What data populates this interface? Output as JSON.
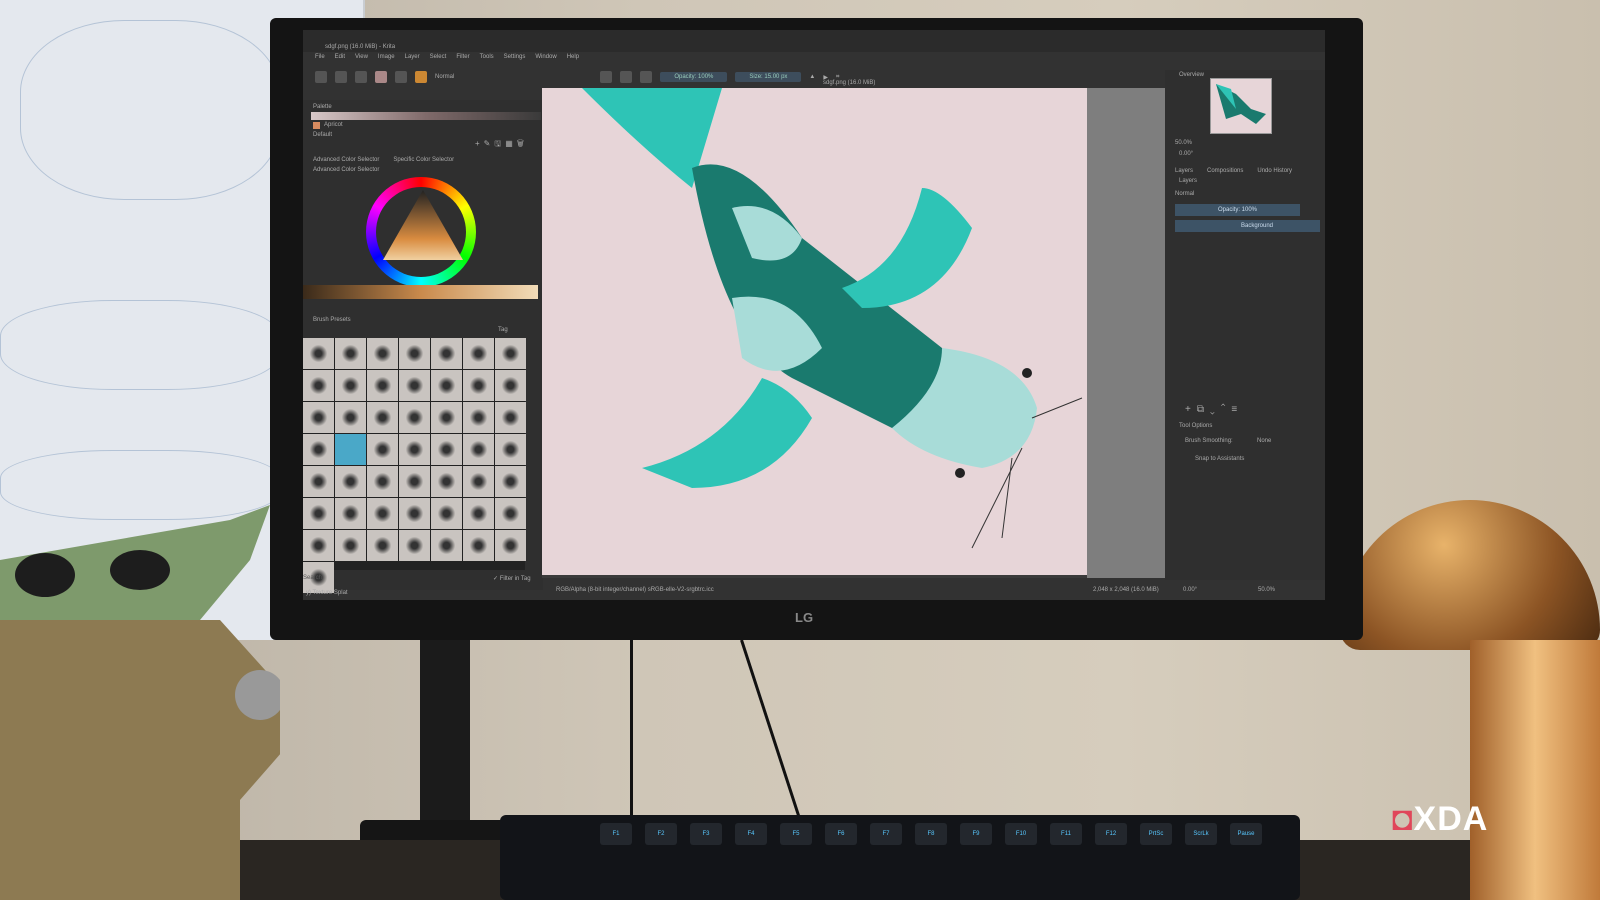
{
  "window": {
    "title": "sdgf.png (16.0 MiB) - Krita",
    "canvas_tab": "sdgf.png (16.0 MiB)"
  },
  "menu": [
    "File",
    "Edit",
    "View",
    "Image",
    "Layer",
    "Select",
    "Filter",
    "Tools",
    "Settings",
    "Window",
    "Help"
  ],
  "toolbar": {
    "blend_mode": "Normal",
    "opacity": "Opacity: 100%",
    "size": "Size: 15.00 px"
  },
  "palette": {
    "title": "Palette",
    "color_name": "Apricot",
    "palette_name": "Default"
  },
  "color_selector": {
    "tabs": [
      "Advanced Color Selector",
      "Specific Color Selector"
    ],
    "title": "Advanced Color Selector"
  },
  "brush_presets": {
    "title": "Brush Presets",
    "tag_label": "Tag",
    "search_placeholder": "Search",
    "filter_label": "Filter in Tag",
    "current_preset": "y) Texture Splat"
  },
  "overview": {
    "title": "Overview",
    "zoom": "50.0%",
    "rotation": "0.00°"
  },
  "layers": {
    "tabs": [
      "Layers",
      "Compositions",
      "Undo History"
    ],
    "title": "Layers",
    "blend_mode": "Normal",
    "opacity": "Opacity: 100%",
    "items": [
      {
        "name": "Background"
      }
    ]
  },
  "tool_options": {
    "title": "Tool Options",
    "smoothing_label": "Brush Smoothing:",
    "smoothing_value": "None",
    "snap_label": "Snap to Assistants"
  },
  "status": {
    "color_space": "RGB/Alpha (8-bit integer/channel)  sRGB-elle-V2-srgbtrc.icc",
    "dimensions": "2,048 x 2,048 (16.0 MiB)",
    "rotation": "0.00°",
    "zoom": "50.0%"
  },
  "monitor_brand": "LG",
  "watermark": "XDA",
  "keyboard_keys": [
    "F1",
    "F2",
    "F3",
    "F4",
    "F5",
    "F6",
    "F7",
    "F8",
    "F9",
    "F10",
    "F11",
    "F12",
    "PrtSc",
    "ScrLk",
    "Pause"
  ],
  "colors": {
    "accent": "#3d5366",
    "fish_teal": "#2ec4b6",
    "fish_dark": "#1a7a6e",
    "fish_light": "#a8dcd8",
    "canvas_bg": "#e7d5d8"
  }
}
